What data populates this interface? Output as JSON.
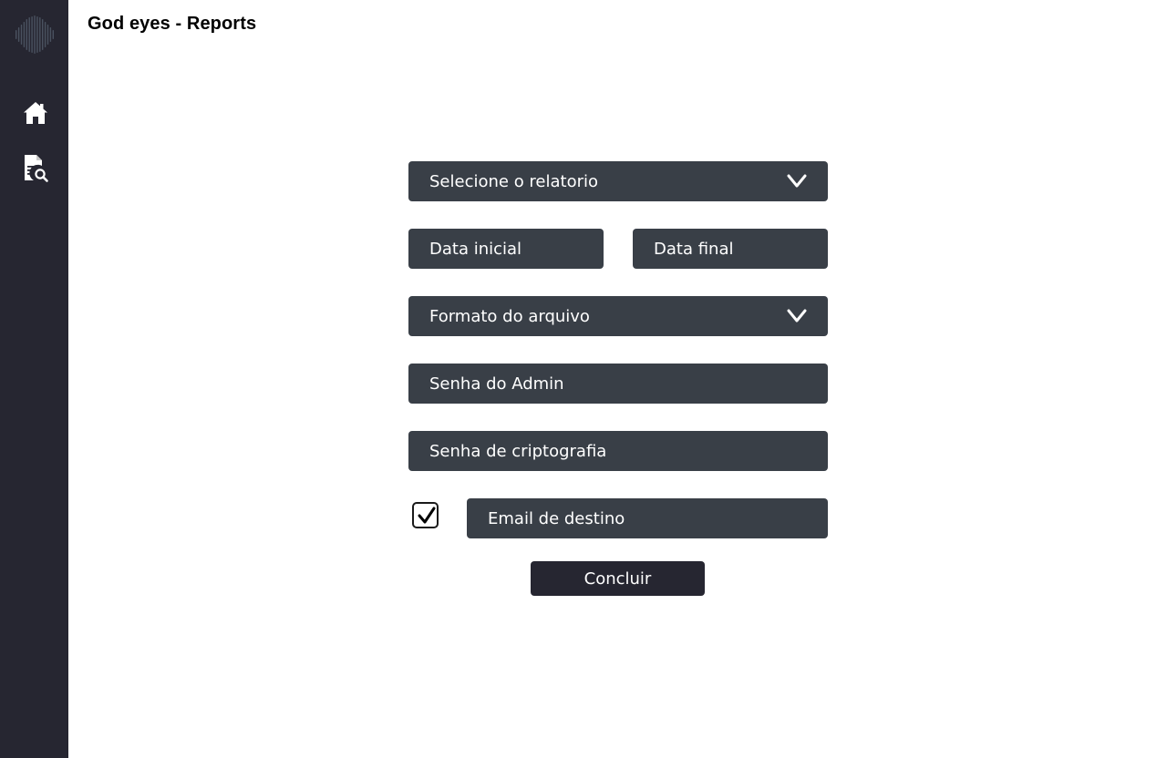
{
  "app": {
    "title": "God eyes - Reports"
  },
  "sidebar": {
    "logo": "soundwave-logo",
    "items": [
      {
        "id": "home",
        "icon": "home-icon"
      },
      {
        "id": "reports",
        "icon": "report-search-icon"
      }
    ]
  },
  "form": {
    "report_select": {
      "placeholder": "Selecione o relatorio",
      "icon": "chevron-down-icon"
    },
    "start_date": {
      "placeholder": "Data inicial"
    },
    "end_date": {
      "placeholder": "Data final"
    },
    "format_select": {
      "placeholder": "Formato do arquivo",
      "icon": "chevron-down-icon"
    },
    "admin_password": {
      "placeholder": "Senha do Admin"
    },
    "crypto_password": {
      "placeholder": "Senha de criptografia"
    },
    "email_checkbox": {
      "checked": true
    },
    "email": {
      "placeholder": "Email de destino"
    },
    "submit_label": "Concluir"
  },
  "colors": {
    "sidebar_bg": "#262631",
    "field_bg": "#393f47",
    "button_bg": "#262631",
    "text_light": "#ffffff"
  }
}
